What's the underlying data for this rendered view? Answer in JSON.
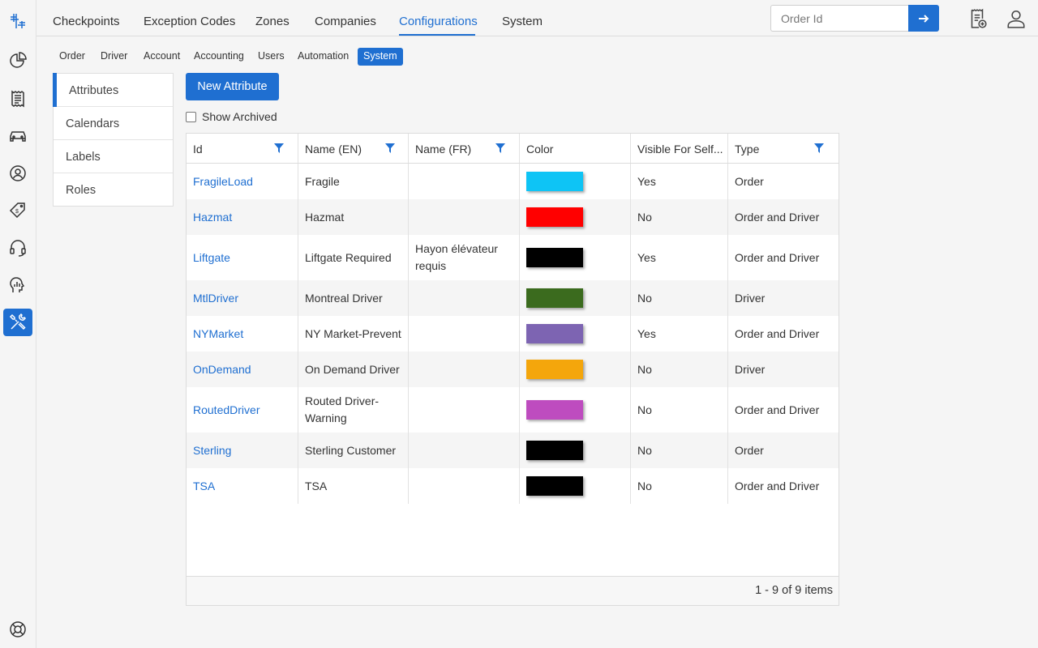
{
  "rail": {
    "items": [
      {
        "icon": "logo-icon"
      },
      {
        "icon": "pie-chart-icon"
      },
      {
        "icon": "receipt-icon"
      },
      {
        "icon": "car-icon"
      },
      {
        "icon": "user-circle-icon"
      },
      {
        "icon": "price-tag-icon"
      },
      {
        "icon": "headset-icon"
      },
      {
        "icon": "head-analytics-icon"
      },
      {
        "icon": "tools-icon",
        "active": true
      },
      {
        "icon": "lifebuoy-icon"
      }
    ]
  },
  "topnav": {
    "items": [
      "Checkpoints",
      "Exception Codes",
      "Zones",
      "Companies",
      "Configurations",
      "System"
    ],
    "active": "Configurations",
    "search_placeholder": "Order Id"
  },
  "subnav": {
    "items": [
      "Order",
      "Driver",
      "Account",
      "Accounting",
      "Users",
      "Automation",
      "System"
    ],
    "active": "System"
  },
  "sidemenu": {
    "items": [
      "Attributes",
      "Calendars",
      "Labels",
      "Roles"
    ],
    "active": "Attributes"
  },
  "toolbar": {
    "new_label": "New Attribute",
    "archived_label": "Show Archived"
  },
  "grid": {
    "columns": [
      "Id",
      "Name (EN)",
      "Name (FR)",
      "Color",
      "Visible For Self...",
      "Type"
    ],
    "rows": [
      {
        "id": "FragileLoad",
        "name_en": "Fragile",
        "name_fr": "",
        "color": "#0ec4f5",
        "visible": "Yes",
        "type": "Order"
      },
      {
        "id": "Hazmat",
        "name_en": "Hazmat",
        "name_fr": "",
        "color": "#ff0000",
        "visible": "No",
        "type": "Order and Driver"
      },
      {
        "id": "Liftgate",
        "name_en": "Liftgate Required",
        "name_fr": "Hayon élévateur requis",
        "color": "#000000",
        "visible": "Yes",
        "type": "Order and Driver"
      },
      {
        "id": "MtlDriver",
        "name_en": "Montreal Driver",
        "name_fr": "",
        "color": "#3b6b1e",
        "visible": "No",
        "type": "Driver"
      },
      {
        "id": "NYMarket",
        "name_en": "NY Market-Prevent",
        "name_fr": "",
        "color": "#7d64b2",
        "visible": "Yes",
        "type": "Order and Driver"
      },
      {
        "id": "OnDemand",
        "name_en": "On Demand Driver",
        "name_fr": "",
        "color": "#f4a60c",
        "visible": "No",
        "type": "Driver"
      },
      {
        "id": "RoutedDriver",
        "name_en": "Routed Driver-Warning",
        "name_fr": "",
        "color": "#be4cbf",
        "visible": "No",
        "type": "Order and Driver"
      },
      {
        "id": "Sterling",
        "name_en": "Sterling Customer",
        "name_fr": "",
        "color": "#000000",
        "visible": "No",
        "type": "Order"
      },
      {
        "id": "TSA",
        "name_en": "TSA",
        "name_fr": "",
        "color": "#000000",
        "visible": "No",
        "type": "Order and Driver"
      }
    ],
    "pager_info": "1 - 9 of 9 items"
  },
  "colors": {
    "accent": "#1f6fd1"
  }
}
